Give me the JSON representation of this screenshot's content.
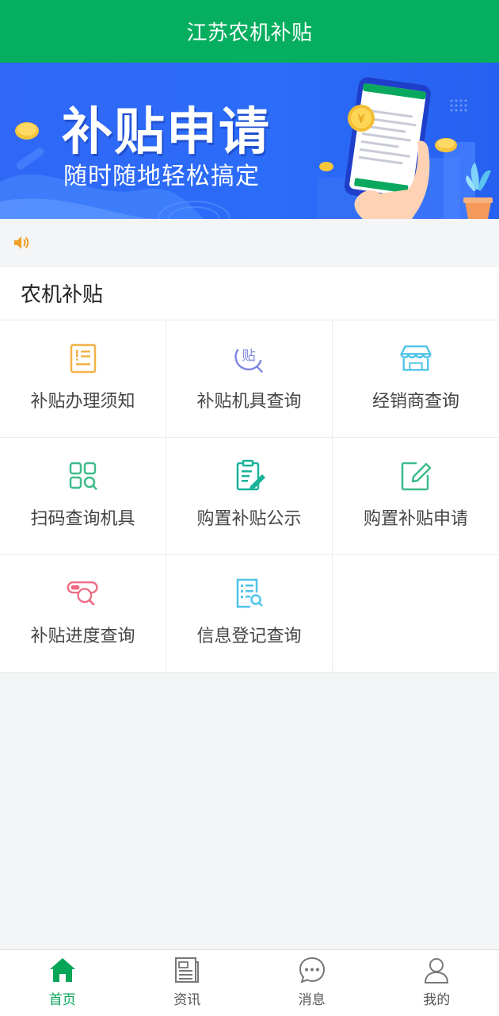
{
  "header": {
    "title": "江苏农机补贴"
  },
  "banner": {
    "title": "补贴申请",
    "subtitle": "随时随地轻松搞定"
  },
  "notice": {
    "icon": "speaker-icon",
    "text": ""
  },
  "section": {
    "title": "农机补贴",
    "items": [
      {
        "label": "补贴办理须知",
        "icon": "notice-document-icon",
        "color": "#f2b34a"
      },
      {
        "label": "补贴机具查询",
        "icon": "subsidy-search-icon",
        "color": "#7f86e0"
      },
      {
        "label": "经销商查询",
        "icon": "store-icon",
        "color": "#4fc3e8"
      },
      {
        "label": "扫码查询机具",
        "icon": "qr-scan-icon",
        "color": "#3dbb8a"
      },
      {
        "label": "购置补贴公示",
        "icon": "clipboard-edit-icon",
        "color": "#1ab39a"
      },
      {
        "label": "购置补贴申请",
        "icon": "edit-square-icon",
        "color": "#3dbb8a"
      },
      {
        "label": "补贴进度查询",
        "icon": "progress-search-icon",
        "color": "#ee6a82"
      },
      {
        "label": "信息登记查询",
        "icon": "list-search-icon",
        "color": "#4fc3e8"
      }
    ]
  },
  "tabbar": {
    "active_color": "#07a558",
    "tabs": [
      {
        "label": "首页",
        "icon": "home-icon",
        "active": true
      },
      {
        "label": "资讯",
        "icon": "news-icon",
        "active": false
      },
      {
        "label": "消息",
        "icon": "message-icon",
        "active": false
      },
      {
        "label": "我的",
        "icon": "user-icon",
        "active": false
      }
    ]
  }
}
